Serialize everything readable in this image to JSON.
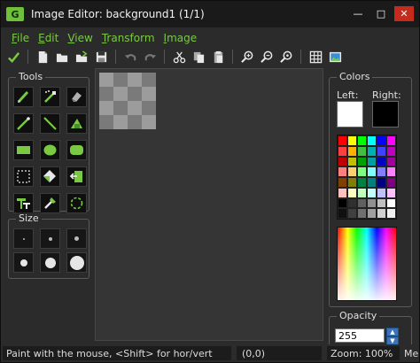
{
  "window": {
    "title": "Image Editor: background1 (1/1)",
    "app_icon_text": "G",
    "buttons": {
      "minimize": "—",
      "maximize": "□",
      "close": "✕"
    }
  },
  "menu": [
    {
      "label": "File",
      "mnemonic": "F"
    },
    {
      "label": "Edit",
      "mnemonic": "E"
    },
    {
      "label": "View",
      "mnemonic": "V"
    },
    {
      "label": "Transform",
      "mnemonic": "T"
    },
    {
      "label": "Image",
      "mnemonic": "I"
    }
  ],
  "toolbar": {
    "groups": [
      [
        "ok-icon"
      ],
      [
        "new-icon",
        "open-icon",
        "open-alt-icon",
        "save-icon"
      ],
      [
        "undo-icon",
        "redo-icon"
      ],
      [
        "cut-icon",
        "copy-icon",
        "paste-icon"
      ],
      [
        "zoom-in-icon",
        "zoom-out-icon",
        "zoom-reset-icon"
      ],
      [
        "grid-icon",
        "image-icon"
      ]
    ]
  },
  "tools": {
    "title": "Tools",
    "items": [
      "pencil-icon",
      "spray-icon",
      "eraser-icon",
      "line-icon",
      "diagonal-line-icon",
      "fill-shape-icon",
      "rectangle-icon",
      "ellipse-icon",
      "rounded-rectangle-icon",
      "select-icon",
      "fill-bucket-icon",
      "exit-icon",
      "text-icon",
      "eyedropper-icon",
      "magic-select-icon"
    ]
  },
  "size": {
    "title": "Size",
    "levels": [
      1,
      2,
      3,
      4,
      5,
      6
    ]
  },
  "colors": {
    "title": "Colors",
    "left_label": "Left:",
    "right_label": "Right:",
    "left_color": "#ffffff",
    "right_color": "#000000",
    "palette": [
      "#ff0000",
      "#ffff00",
      "#00ff00",
      "#00ffff",
      "#0000ff",
      "#ff00ff",
      "#ff4040",
      "#ffb000",
      "#40c040",
      "#00b0b0",
      "#4040ff",
      "#c000c0",
      "#c00000",
      "#c0c000",
      "#00a000",
      "#00a0a0",
      "#0000c0",
      "#a000a0",
      "#ff8080",
      "#ffd070",
      "#80ff80",
      "#80ffff",
      "#8080ff",
      "#ff80ff",
      "#804000",
      "#808000",
      "#008040",
      "#008080",
      "#000080",
      "#800080",
      "#ffc0c0",
      "#ffffc0",
      "#c0ffc0",
      "#c0ffff",
      "#c0c0ff",
      "#ffc0ff",
      "#000000",
      "#303030",
      "#606060",
      "#909090",
      "#c0c0c0",
      "#ffffff",
      "#101010",
      "#404040",
      "#707070",
      "#a0a0a0",
      "#d0d0d0",
      "#f0f0f0"
    ]
  },
  "opacity": {
    "title": "Opacity",
    "value": "255"
  },
  "status": {
    "hint": "Paint with the mouse, <Shift> for hor/vert",
    "coords": "(0,0)",
    "zoom": "Zoom: 100%",
    "extra": "Me"
  }
}
